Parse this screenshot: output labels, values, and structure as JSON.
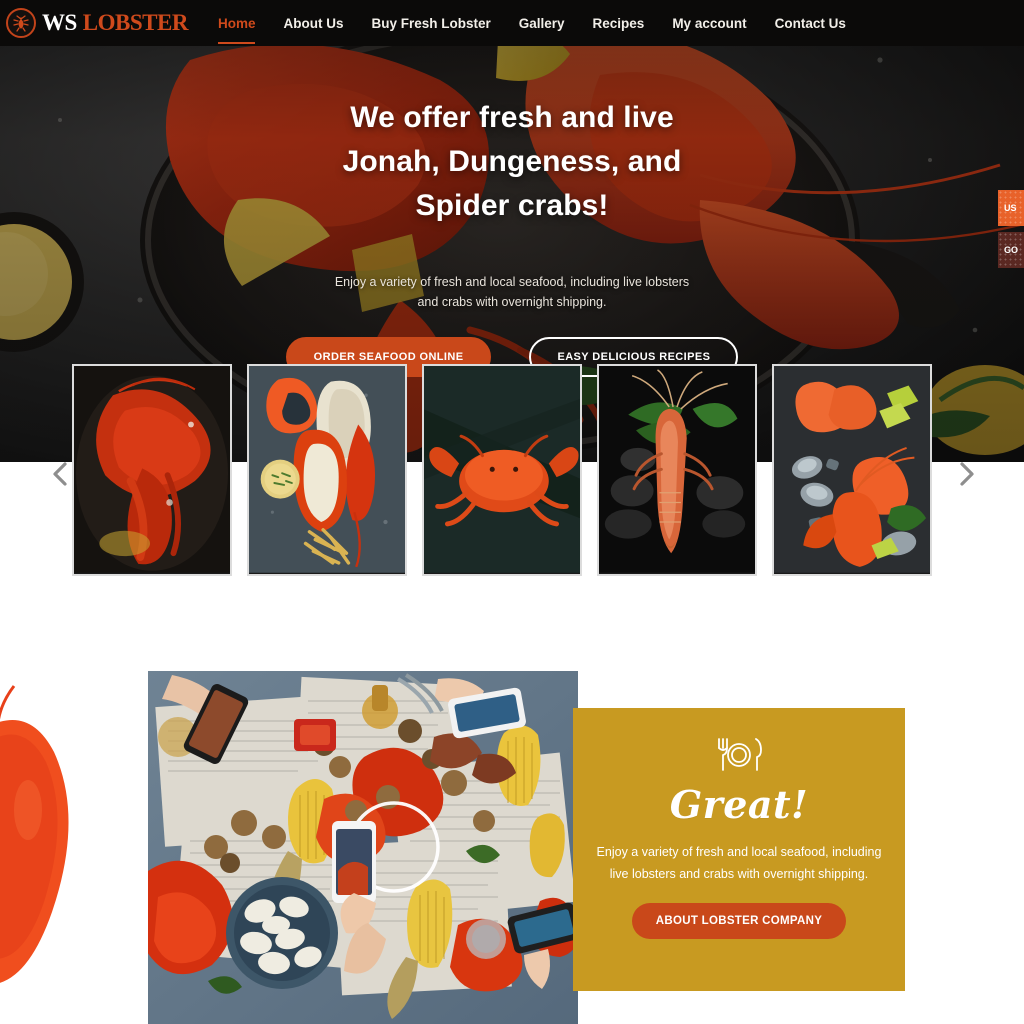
{
  "header": {
    "logo": {
      "icon": "lobster-emblem-icon",
      "word1": "WS",
      "word2": "LOBSTER"
    },
    "nav": [
      {
        "label": "Home",
        "active": true
      },
      {
        "label": "About Us",
        "active": false
      },
      {
        "label": "Buy Fresh Lobster",
        "active": false
      },
      {
        "label": "Gallery",
        "active": false
      },
      {
        "label": "Recipes",
        "active": false
      },
      {
        "label": "My account",
        "active": false
      },
      {
        "label": "Contact Us",
        "active": false
      }
    ]
  },
  "hero": {
    "title_line1": "We offer fresh and live",
    "title_line2": "Jonah, Dungeness, and",
    "title_line3": "Spider crabs!",
    "subtitle_line1": "Enjoy a variety of fresh and local seafood, including live lobsters",
    "subtitle_line2": "and crabs with overnight shipping.",
    "primary_button": "ORDER SEAFOOD ONLINE",
    "secondary_button": "EASY DELICIOUS RECIPES",
    "side_tabs": [
      {
        "label": "US",
        "color": "#e8622a"
      },
      {
        "label": "GO",
        "color": "#5a2822"
      }
    ]
  },
  "carousel": {
    "prev_icon": "chevron-left-icon",
    "next_icon": "chevron-right-icon",
    "slides": [
      {
        "alt": "whole-red-lobster"
      },
      {
        "alt": "split-lobster-with-fries"
      },
      {
        "alt": "cooked-crab"
      },
      {
        "alt": "spiny-lobster-on-stones"
      },
      {
        "alt": "lobster-and-oysters-platter"
      }
    ]
  },
  "feature": {
    "decor_icon": "lobster-claw-decoration",
    "photo_alt": "seafood-boil-table-with-phones",
    "card": {
      "icon": "cutlery-plate-icon",
      "heading": "Great!",
      "text_line1": "Enjoy a variety of fresh and local seafood, including",
      "text_line2": "live lobsters and crabs with overnight shipping.",
      "button": "ABOUT LOBSTER COMPANY",
      "bg_color": "#c89a21",
      "button_color": "#c9481a"
    }
  },
  "colors": {
    "accent_orange": "#cf4a1c",
    "button_orange": "#c9481a",
    "gold": "#c89a21",
    "header_bg": "#0b0a09"
  }
}
